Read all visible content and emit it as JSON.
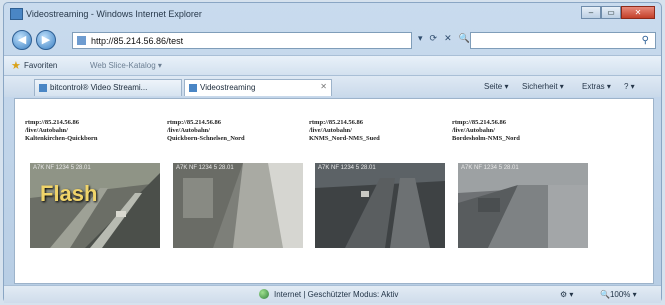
{
  "window": {
    "title": "Videostreaming - Windows Internet Explorer",
    "controls": {
      "minimize": "–",
      "maximize": "▭",
      "close": "✕"
    }
  },
  "address": {
    "back": "◀",
    "forward": "▶",
    "url": "http://85.214.56.86/test",
    "tools": [
      "▾",
      "⟳",
      "✕",
      "🔍"
    ],
    "search_icon": "⚲"
  },
  "favorites": {
    "label": "Favoriten",
    "link": "Web Slice-Katalog ▾"
  },
  "tabs": [
    {
      "label": "bitcontrol® Video Streami...",
      "icon": "page-icon"
    },
    {
      "label": "Videostreaming",
      "icon": "page-icon",
      "close": "✕"
    }
  ],
  "commands": [
    "Seite ▾",
    "Sicherheit ▾",
    "Extras ▾",
    "? ▾"
  ],
  "cameras": [
    {
      "line1": "rtmp://85.214.56.86",
      "line2": "/live/Autobahn/",
      "line3": "Kaltenkirchen-Quickborn",
      "overlay": "Flash",
      "timestamp": "A7K NF 1234 5 28.01"
    },
    {
      "line1": "rtmp://85.214.56.86",
      "line2": "/live/Autobahn/",
      "line3": "Quickborn-Schnelsen_Nord",
      "timestamp": "A7K NF 1234 5 28.01"
    },
    {
      "line1": "rtmp://85.214.56.86",
      "line2": "/live/Autobahn/",
      "line3": "KNMS_Nord-NMS_Sued",
      "timestamp": "A7K NF 1234 5 28.01"
    },
    {
      "line1": "rtmp://85.214.56.86",
      "line2": "/live/Autobahn/",
      "line3": "Bordesholm-NMS_Nord",
      "timestamp": "A7K NF 1234 5 28.01"
    }
  ],
  "status": {
    "text": "Internet | Geschützter Modus: Aktiv",
    "tool": "⚙ ▾",
    "zoom": "🔍100% ▾"
  }
}
